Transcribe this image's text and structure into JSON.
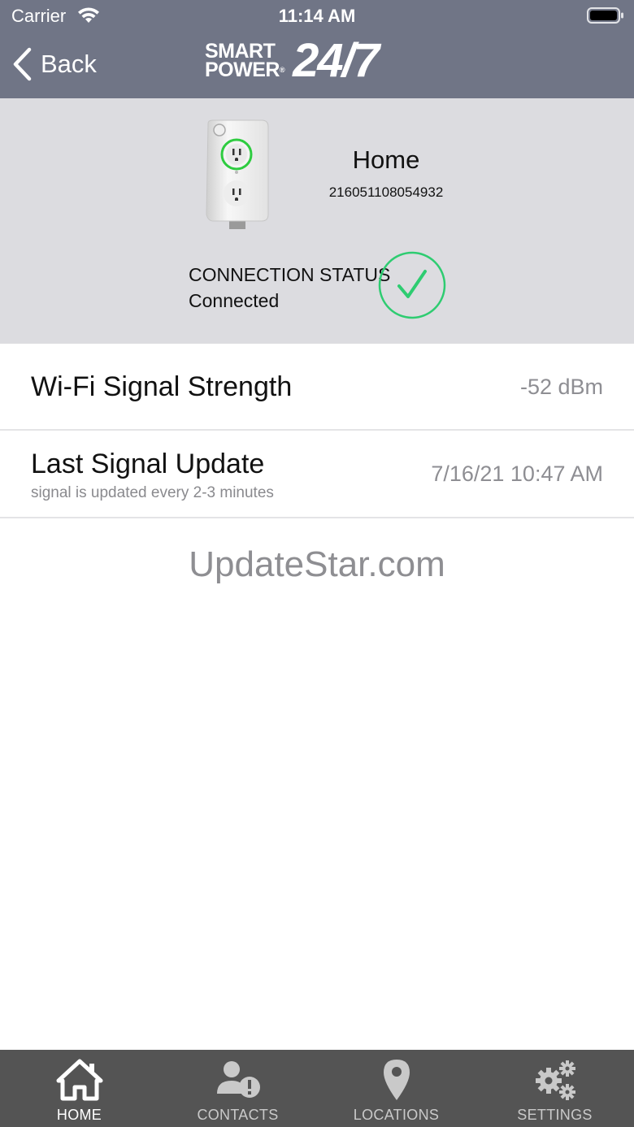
{
  "status_bar": {
    "carrier": "Carrier",
    "time": "11:14 AM"
  },
  "nav": {
    "back_label": "Back",
    "logo": {
      "line1": "SMART",
      "line2": "POWER",
      "registered": "®",
      "big": "24/7"
    }
  },
  "device": {
    "name": "Home",
    "serial": "216051108054932",
    "connection_label": "CONNECTION STATUS",
    "connection_value": "Connected"
  },
  "rows": {
    "wifi": {
      "title": "Wi-Fi Signal Strength",
      "value": "-52 dBm"
    },
    "last_update": {
      "title": "Last Signal Update",
      "subtitle": "signal is updated every 2-3 minutes",
      "value": "7/16/21 10:47 AM"
    }
  },
  "watermark": "UpdateStar.com",
  "tabs": [
    {
      "label": "HOME",
      "icon": "home-icon",
      "active": true
    },
    {
      "label": "CONTACTS",
      "icon": "contacts-alert-icon",
      "active": false
    },
    {
      "label": "LOCATIONS",
      "icon": "location-pin-icon",
      "active": false
    },
    {
      "label": "SETTINGS",
      "icon": "gears-icon",
      "active": false
    }
  ],
  "colors": {
    "header": "#707586",
    "panel": "#dcdce0",
    "tab_bar": "#545454",
    "success": "#2ecc71"
  }
}
